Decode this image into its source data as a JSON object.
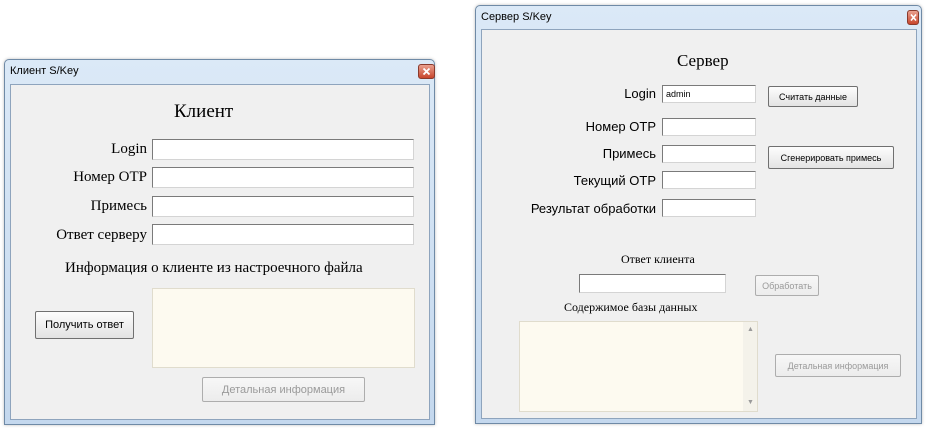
{
  "client": {
    "title": "Клиент S/Key",
    "heading": "Клиент",
    "labels": {
      "login": "Login",
      "otp": "Номер OTP",
      "salt": "Примесь",
      "answer": "Ответ серверу"
    },
    "fields": {
      "login": "",
      "otp": "",
      "salt": "",
      "answer": ""
    },
    "info_heading": "Информация о клиенте из настроечного файла",
    "get_answer_button": "Получить ответ",
    "details_button": "Детальная информация"
  },
  "server": {
    "title": "Сервер S/Key",
    "heading": "Сервер",
    "labels": {
      "login": "Login",
      "otp": "Номер OTP",
      "salt": "Примесь",
      "current_otp": "Текущий OTP",
      "result": "Результат обработки"
    },
    "fields": {
      "login": "admin",
      "otp": "",
      "salt": "",
      "current_otp": "",
      "result": ""
    },
    "read_data_button": "Считать данные",
    "generate_salt_button": "Сгенерировать примесь",
    "client_answer_heading": "Ответ клиента",
    "client_answer_value": "",
    "process_button": "Обработать",
    "db_heading": "Содержимое базы данных",
    "details_button": "Детальная информация"
  },
  "colors": {
    "window_bg": "#f0f0f0",
    "memo_bg": "#fdfaf0",
    "titlebar": "#c4d8ee",
    "close_button": "#c8452c"
  }
}
